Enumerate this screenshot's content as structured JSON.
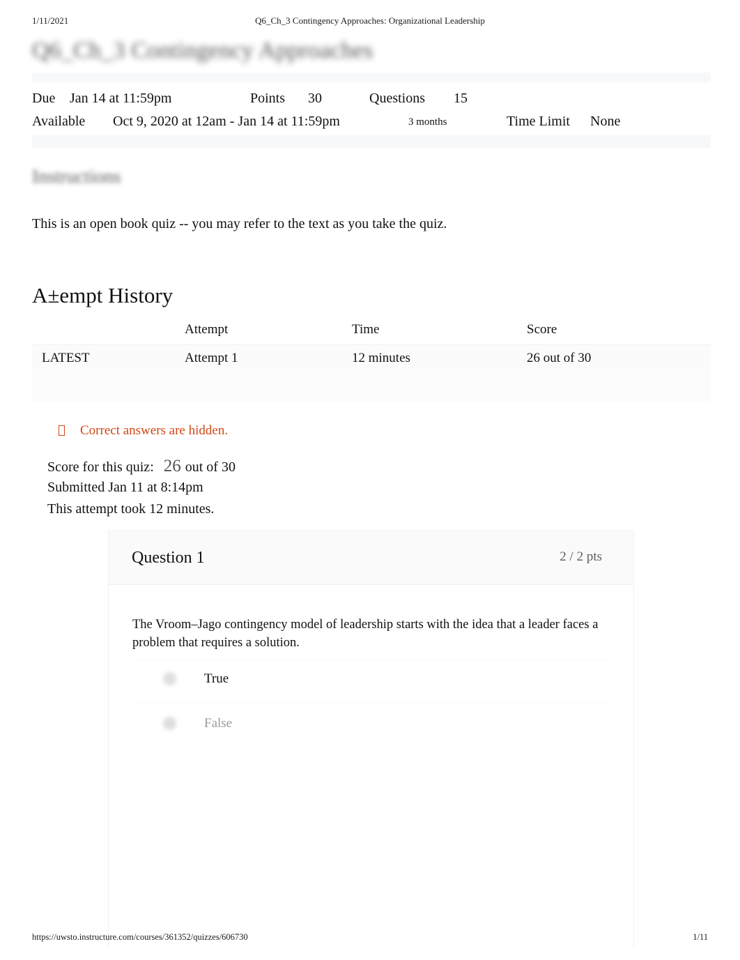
{
  "print": {
    "date": "1/11/2021",
    "doc_title": "Q6_Ch_3 Contingency Approaches: Organizational Leadership",
    "url": "https://uwsto.instructure.com/courses/361352/quizzes/606730",
    "page_number": "1/11"
  },
  "quiz": {
    "title": "Q6_Ch_3 Contingency Approaches",
    "meta": {
      "due_label": "Due",
      "due_value": "Jan 14 at 11:59pm",
      "points_label": "Points",
      "points_value": "30",
      "questions_label": "Questions",
      "questions_value": "15",
      "available_label": "Available",
      "available_value": "Oct 9, 2020 at 12am - Jan 14 at 11:59pm",
      "duration_value": "3 months",
      "time_limit_label": "Time Limit",
      "time_limit_value": "None"
    },
    "instructions_heading": "Instructions",
    "instructions_body": "This is an open book quiz -- you may refer to the text as you take the quiz."
  },
  "attempt_history": {
    "heading": "A±empt History",
    "columns": {
      "flag": "",
      "attempt": "Attempt",
      "time": "Time",
      "score": "Score"
    },
    "rows": [
      {
        "flag": "LATEST",
        "attempt": "Attempt 1",
        "time": "12 minutes",
        "score": "26 out of 30"
      }
    ]
  },
  "result_summary": {
    "hidden_notice": "Correct answers are hidden.",
    "hidden_notice_color": "#cf4716",
    "score_label": "Score for this quiz:",
    "score_value": "26",
    "score_suffix": "out of 30",
    "submitted": "Submitted Jan 11 at 8:14pm",
    "duration": "This attempt took 12 minutes."
  },
  "questions": [
    {
      "title": "Question 1",
      "points": "2 / 2 pts",
      "text": "The Vroom–Jago contingency model of leadership starts with the idea that a leader faces a problem that requires a solution.",
      "options": [
        {
          "label": "True",
          "state": "selected"
        },
        {
          "label": "False",
          "state": "unselected"
        }
      ]
    }
  ]
}
